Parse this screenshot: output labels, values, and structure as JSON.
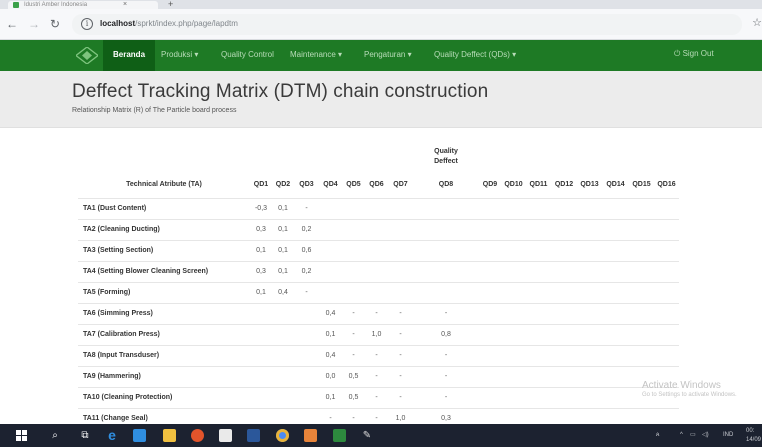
{
  "browser": {
    "tab_title": "Idustri Amber Indonesia",
    "tab_close": "×",
    "new_tab": "+",
    "url_host": "localhost",
    "url_path": "/sprkt/index.php/page/lapdtm"
  },
  "navbar": {
    "items": [
      "Beranda",
      "Produksi ▾",
      "Quality Control",
      "Maintenance ▾",
      "Pengaturan ▾",
      "Quality Deffect (QDs) ▾"
    ],
    "active_index": 0,
    "signout": "Sign Out",
    "bg_color": "#1e7a25"
  },
  "header": {
    "title": "Deffect Tracking Matrix (DTM) chain construction",
    "subtitle": "Relationship Matrix (R) of The Particle board process"
  },
  "table": {
    "group_header_line1": "Quality",
    "group_header_line2": "Deffect",
    "columns": [
      "Technical Atribute (TA)",
      "QD1",
      "QD2",
      "QD3",
      "QD4",
      "QD5",
      "QD6",
      "QD7",
      "QD8",
      "QD9",
      "QD10",
      "QD11",
      "QD12",
      "QD13",
      "QD14",
      "QD15",
      "QD16"
    ],
    "rows": [
      [
        "TA1 (Dust Content)",
        "-0,3",
        "0,1",
        "-",
        "",
        "",
        "",
        "",
        "",
        "",
        "",
        "",
        "",
        "",
        "",
        "",
        ""
      ],
      [
        "TA2 (Cleaning Ducting)",
        "0,3",
        "0,1",
        "0,2",
        "",
        "",
        "",
        "",
        "",
        "",
        "",
        "",
        "",
        "",
        "",
        "",
        ""
      ],
      [
        "TA3 (Setting Section)",
        "0,1",
        "0,1",
        "0,6",
        "",
        "",
        "",
        "",
        "",
        "",
        "",
        "",
        "",
        "",
        "",
        "",
        ""
      ],
      [
        "TA4 (Setting Blower Cleaning Screen)",
        "0,3",
        "0,1",
        "0,2",
        "",
        "",
        "",
        "",
        "",
        "",
        "",
        "",
        "",
        "",
        "",
        "",
        ""
      ],
      [
        "TA5 (Forming)",
        "0,1",
        "0,4",
        "-",
        "",
        "",
        "",
        "",
        "",
        "",
        "",
        "",
        "",
        "",
        "",
        "",
        ""
      ],
      [
        "TA6 (Simming Press)",
        "",
        "",
        "",
        "0,4",
        "-",
        "-",
        "-",
        "-",
        "",
        "",
        "",
        "",
        "",
        "",
        "",
        ""
      ],
      [
        "TA7 (Calibration Press)",
        "",
        "",
        "",
        "0,1",
        "-",
        "1,0",
        "-",
        "0,8",
        "",
        "",
        "",
        "",
        "",
        "",
        "",
        ""
      ],
      [
        "TA8 (Input Transduser)",
        "",
        "",
        "",
        "0,4",
        "-",
        "-",
        "-",
        "-",
        "",
        "",
        "",
        "",
        "",
        "",
        "",
        ""
      ],
      [
        "TA9 (Hammering)",
        "",
        "",
        "",
        "0,0",
        "0,5",
        "-",
        "-",
        "-",
        "",
        "",
        "",
        "",
        "",
        "",
        "",
        ""
      ],
      [
        "TA10 (Cleaning Protection)",
        "",
        "",
        "",
        "0,1",
        "0,5",
        "-",
        "-",
        "-",
        "",
        "",
        "",
        "",
        "",
        "",
        "",
        ""
      ],
      [
        "TA11 (Change Seal)",
        "",
        "",
        "",
        "-",
        "-",
        "-",
        "1,0",
        "0,3",
        "",
        "",
        "",
        "",
        "",
        "",
        "",
        ""
      ]
    ]
  },
  "watermark": {
    "title": "Activate Windows",
    "subtitle": "Go to Settings to activate Windows."
  },
  "taskbar": {
    "lang": "IND",
    "time": "00:",
    "date": "14/09"
  }
}
